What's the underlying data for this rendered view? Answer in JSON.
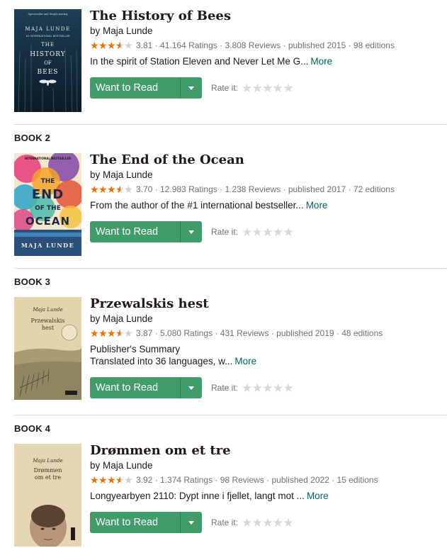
{
  "books": [
    {
      "series_label": "",
      "title": "The History of Bees",
      "author": "by Maja Lunde",
      "rating": "3.81",
      "ratings_count": "41.164 Ratings",
      "reviews_count": "3.808 Reviews",
      "published": "published 2015",
      "editions": "98 editions",
      "description": "In the spirit of Station Eleven and Never Let Me G...",
      "description2": "",
      "more": "More",
      "want_to_read": "Want to Read",
      "rate_it": "Rate it:",
      "cover": {
        "top_text": "Spectacular and deeply moving",
        "author": "MAJA LUNDE",
        "tag": "#1 INTERNATIONAL BESTSELLER",
        "line1": "THE",
        "line2": "HISTORY",
        "line3": "OF",
        "line4": "BEES"
      }
    },
    {
      "series_label": "BOOK 2",
      "title": "The End of the Ocean",
      "author": "by Maja Lunde",
      "rating": "3.70",
      "ratings_count": "12.983 Ratings",
      "reviews_count": "1.238 Reviews",
      "published": "published 2017",
      "editions": "72 editions",
      "description": "From the author of the #1 international bestseller...",
      "description2": "",
      "more": "More",
      "want_to_read": "Want to Read",
      "rate_it": "Rate it:",
      "cover": {
        "tag": "INTERNATIONAL BESTSELLER",
        "line1": "THE",
        "line2": "END",
        "line3": "OF THE",
        "line4": "OCEAN",
        "author": "MAJA LUNDE"
      }
    },
    {
      "series_label": "BOOK 3",
      "title": "Przewalskis hest",
      "author": "by Maja Lunde",
      "rating": "3.87",
      "ratings_count": "5.080 Ratings",
      "reviews_count": "431 Reviews",
      "published": "published 2019",
      "editions": "48 editions",
      "description": "Publisher's Summary",
      "description2": "Translated into 36 languages, w...",
      "more": "More",
      "want_to_read": "Want to Read",
      "rate_it": "Rate it:",
      "cover": {
        "author": "Maja Lunde",
        "line1": "Przewalskis",
        "line2": "hest"
      }
    },
    {
      "series_label": "BOOK 4",
      "title": "Drømmen om et tre",
      "author": "by Maja Lunde",
      "rating": "3.92",
      "ratings_count": "1.374 Ratings",
      "reviews_count": "98 Reviews",
      "published": "published 2022",
      "editions": "15 editions",
      "description": "Longyearbyen 2110: Dypt inne i fjellet, langt mot ...",
      "description2": "",
      "more": "More",
      "want_to_read": "Want to Read",
      "rate_it": "Rate it:",
      "cover": {
        "author": "Maja Lunde",
        "line1": "Drømmen",
        "line2": "om et tre"
      }
    }
  ],
  "colors": {
    "green": "#409d69",
    "star": "#e87400",
    "link": "#00635d"
  }
}
